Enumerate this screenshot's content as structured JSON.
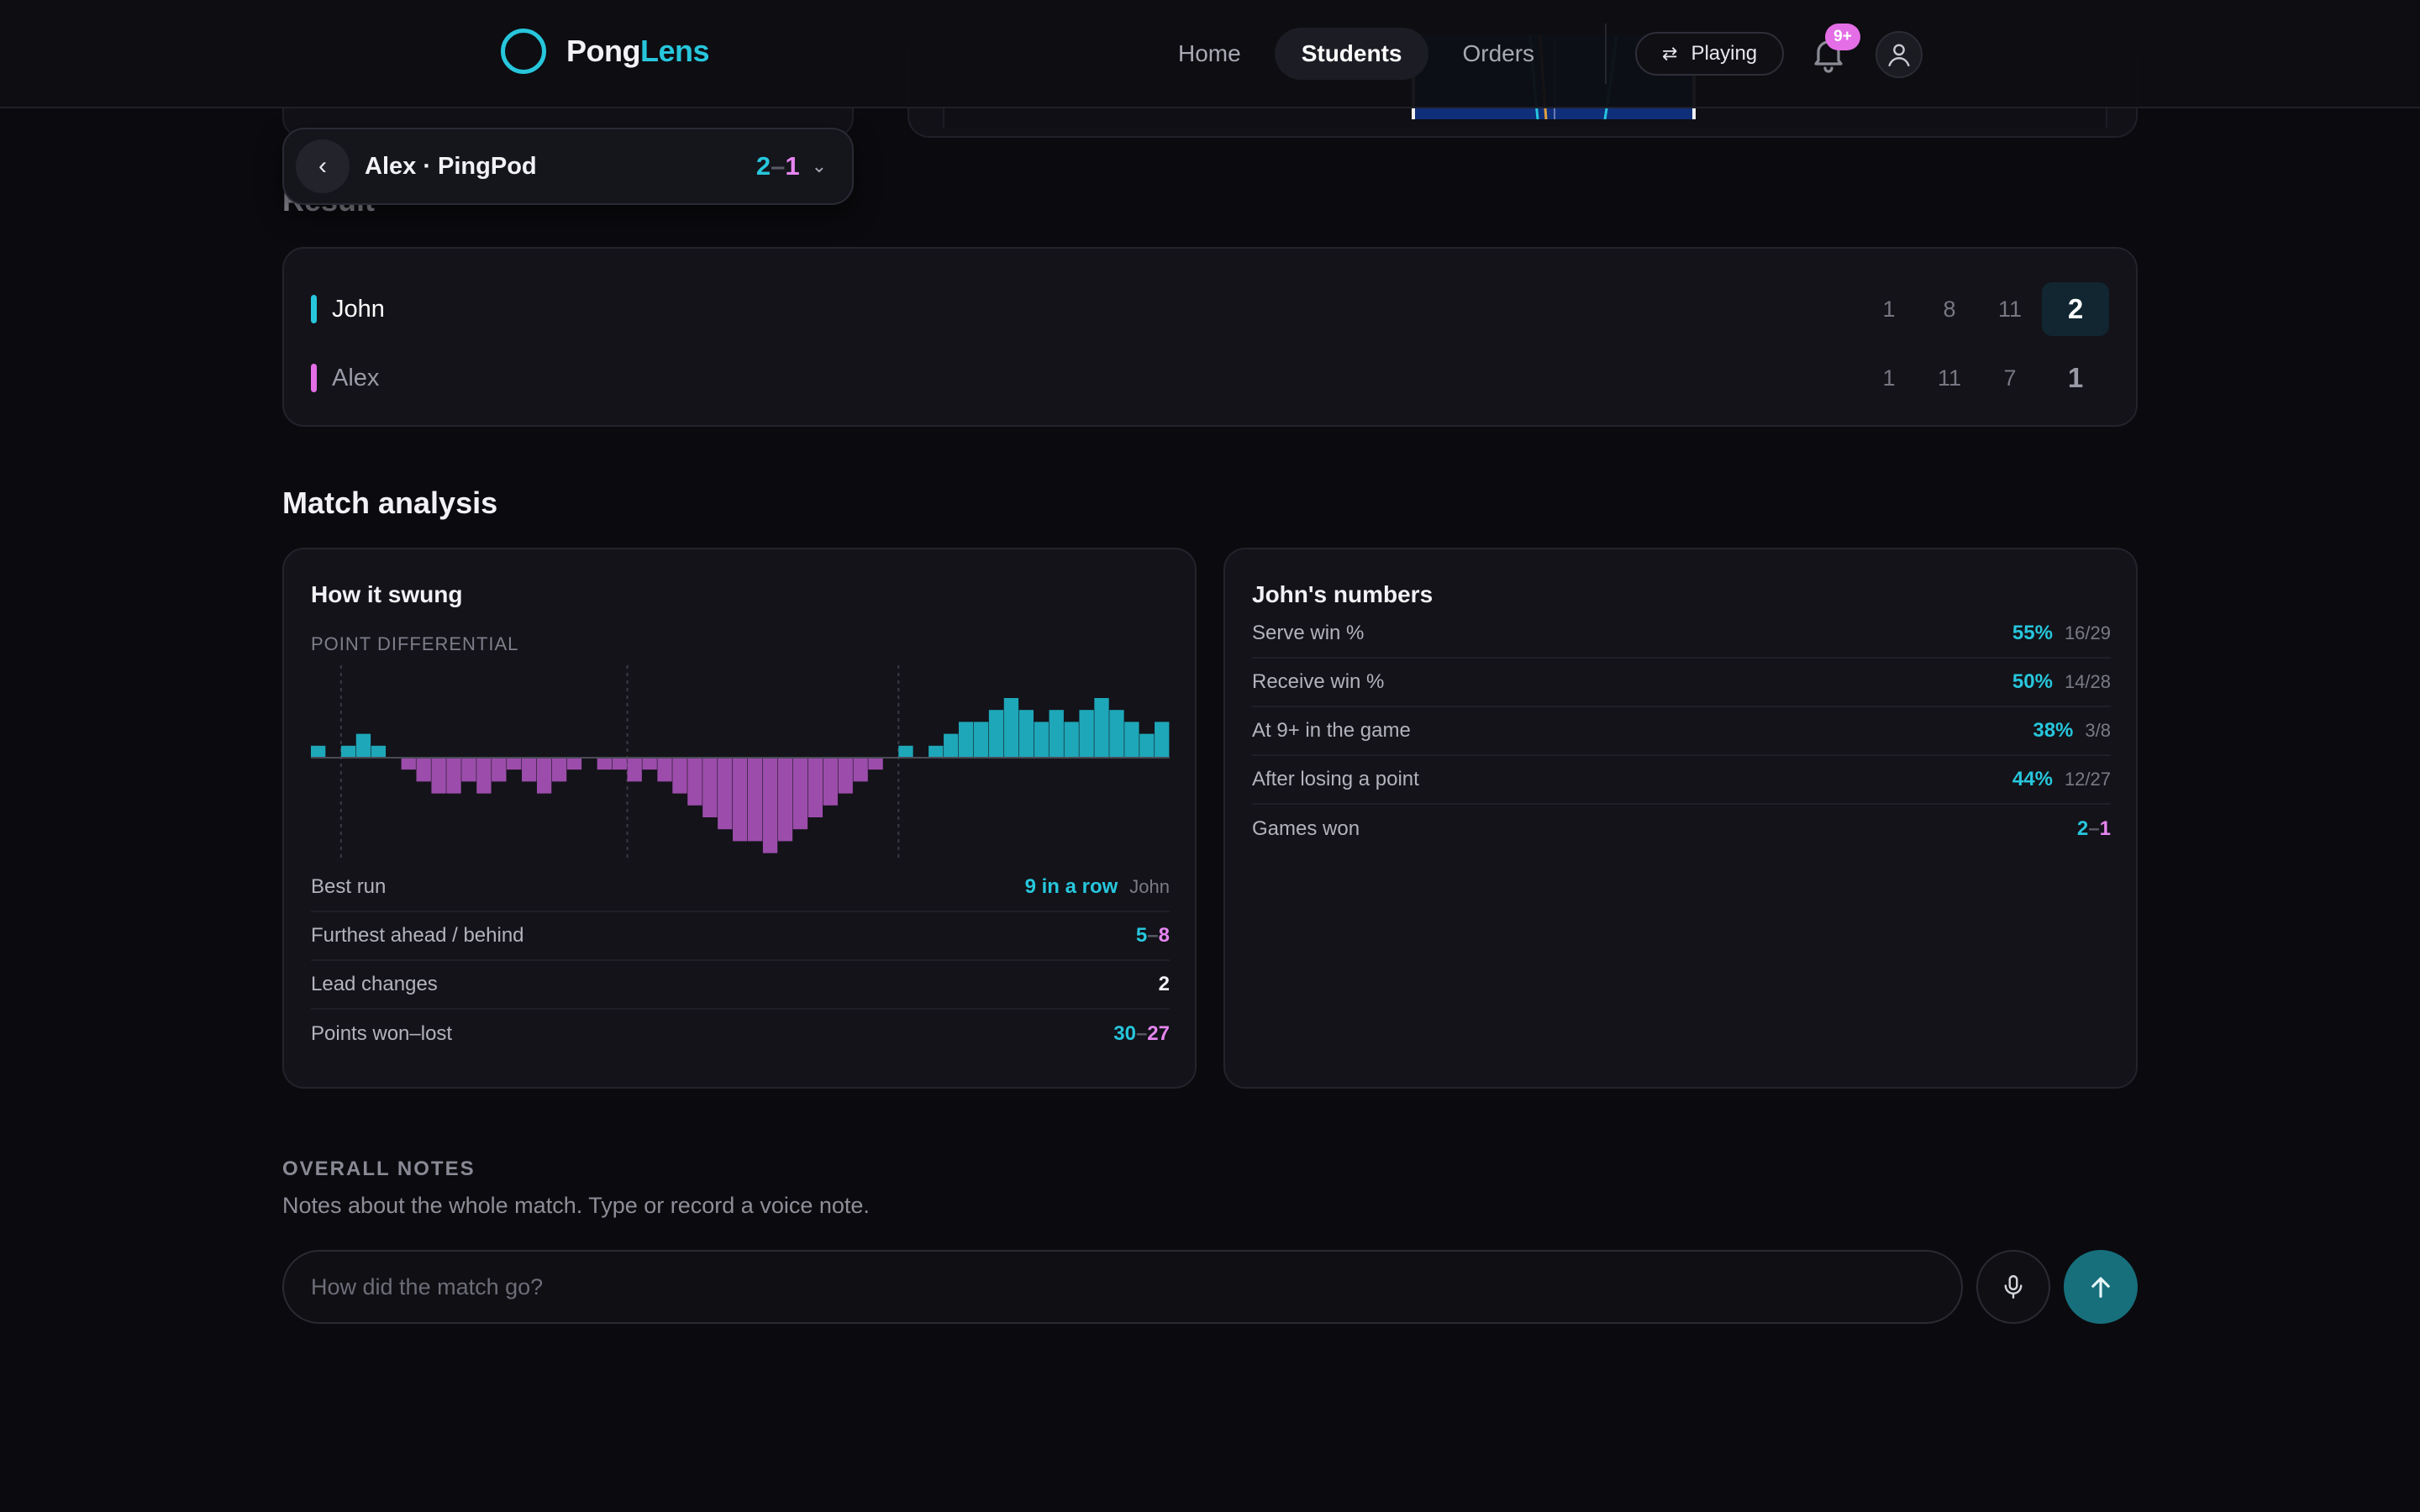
{
  "brand": {
    "name_part1": "Pong",
    "name_part2": "Lens"
  },
  "nav": {
    "items": [
      {
        "label": "Home",
        "active": false
      },
      {
        "label": "Students",
        "active": true
      },
      {
        "label": "Orders",
        "active": false
      }
    ],
    "playing_label": "Playing",
    "notification_badge": "9+"
  },
  "match_pill": {
    "title": "Alex · PingPod",
    "score_a": "2",
    "score_sep": "–",
    "score_b": "1"
  },
  "result": {
    "heading": "Result",
    "players": [
      {
        "name": "John",
        "games": [
          "1",
          "8",
          "11"
        ],
        "total": "2",
        "color": "#27c6dc",
        "winner": true
      },
      {
        "name": "Alex",
        "games": [
          "1",
          "11",
          "7"
        ],
        "total": "1",
        "color": "#e46ee6",
        "winner": false
      }
    ]
  },
  "analysis": {
    "title": "Match analysis",
    "swing_card": {
      "title": "How it swung",
      "chart_label": "POINT DIFFERENTIAL",
      "stats": [
        {
          "label": "Best run",
          "value": "9 in a row",
          "sub": "John"
        },
        {
          "label": "Furthest ahead / behind",
          "value_a": "5",
          "value_b": "8"
        },
        {
          "label": "Lead changes",
          "value": "2"
        },
        {
          "label": "Points won–lost",
          "value_a": "30",
          "value_b": "27"
        }
      ]
    },
    "numbers_card": {
      "title": "John's numbers",
      "stats": [
        {
          "label": "Serve win %",
          "value": "55%",
          "sub": "16/29"
        },
        {
          "label": "Receive win %",
          "value": "50%",
          "sub": "14/28"
        },
        {
          "label": "At 9+ in the game",
          "value": "38%",
          "sub": "3/8"
        },
        {
          "label": "After losing a point",
          "value": "44%",
          "sub": "12/27"
        },
        {
          "label": "Games won",
          "value_a": "2",
          "value_b": "1"
        }
      ]
    }
  },
  "notes": {
    "label": "OVERALL NOTES",
    "description": "Notes about the whole match. Type or record a voice note.",
    "placeholder": "How did the match go?"
  },
  "colors": {
    "john": "#27c6dc",
    "alex": "#e46ee6",
    "bar_pos": "#1ea7b9",
    "bar_neg": "#9c4dab"
  },
  "chart_data": {
    "type": "bar",
    "ylabel": "POINT DIFFERENTIAL",
    "game_boundaries_after_point": [
      2,
      21,
      39
    ],
    "values": [
      1,
      0,
      1,
      2,
      1,
      0,
      -1,
      -2,
      -3,
      -3,
      -2,
      -3,
      -2,
      -1,
      -2,
      -3,
      -2,
      -1,
      0,
      -1,
      -1,
      -2,
      -1,
      -2,
      -3,
      -4,
      -5,
      -6,
      -7,
      -7,
      -8,
      -7,
      -6,
      -5,
      -4,
      -3,
      -2,
      -1,
      0,
      1,
      0,
      1,
      2,
      3,
      3,
      4,
      5,
      4,
      3,
      4,
      3,
      4,
      5,
      4,
      3,
      2,
      3
    ],
    "ylim": [
      -8,
      5
    ]
  }
}
